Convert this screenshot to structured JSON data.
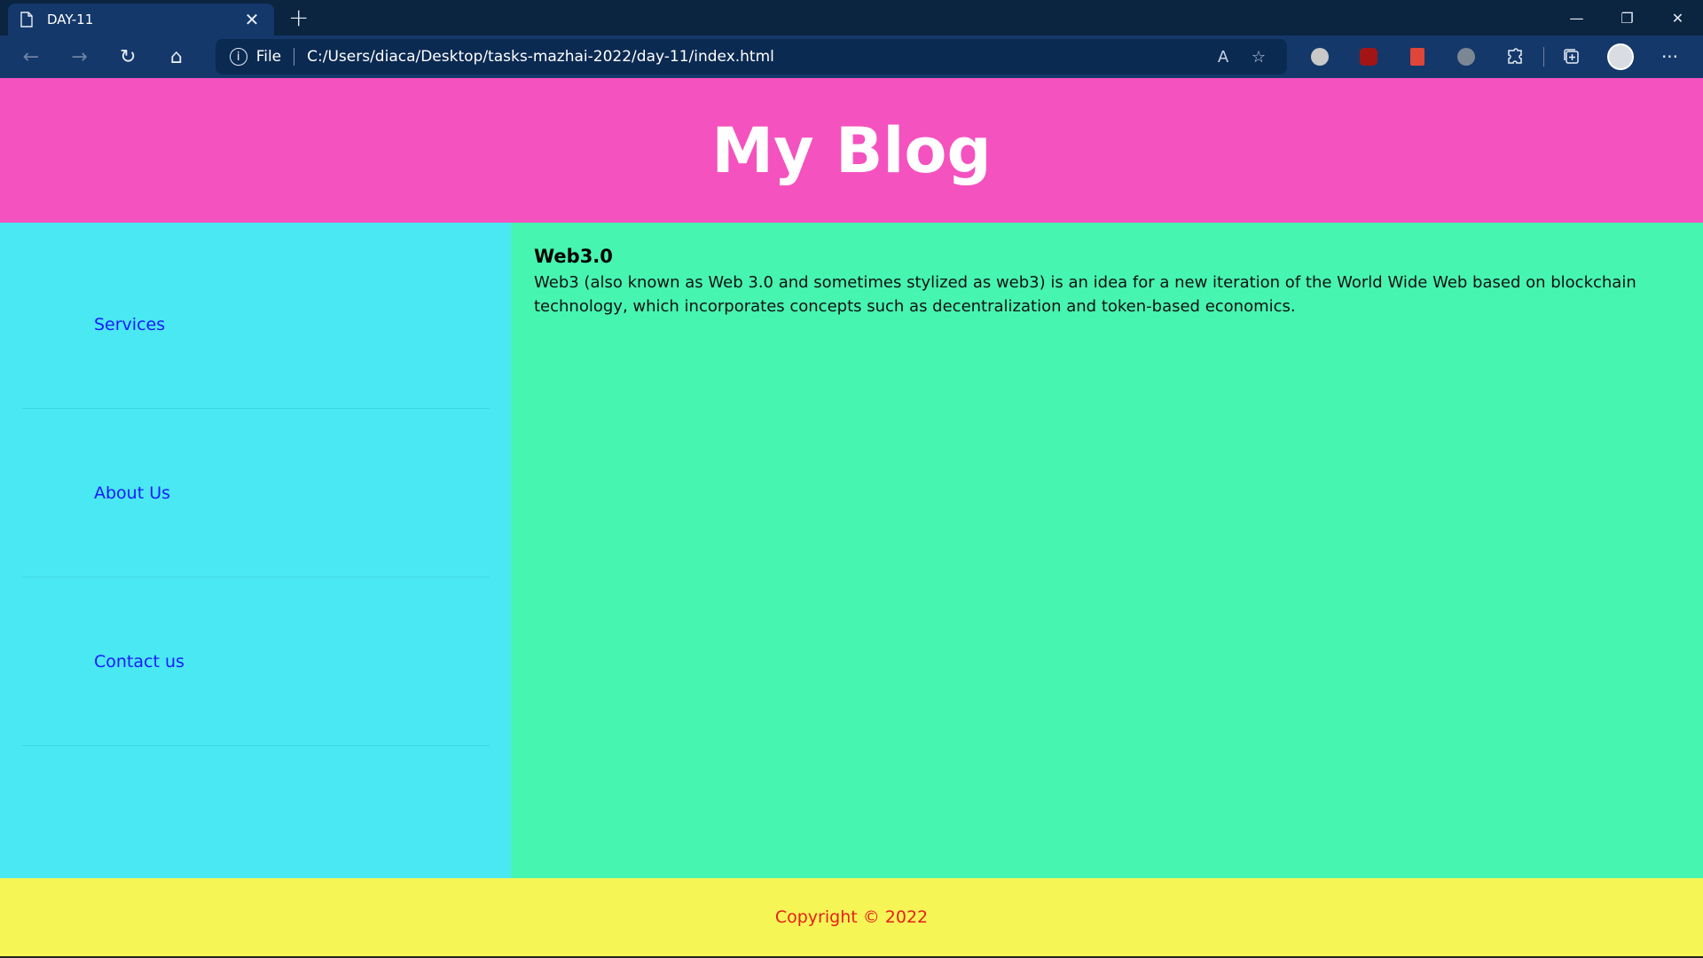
{
  "browser": {
    "tab_title": "DAY-11",
    "tab_close": "✕",
    "new_tab": "+",
    "window_controls": {
      "minimize": "—",
      "restore": "❐",
      "close": "✕"
    },
    "nav": {
      "back": "←",
      "forward": "→",
      "reload": "↻",
      "home": "⌂"
    },
    "address": {
      "info": "i",
      "scheme": "File",
      "url": "C:/Users/diaca/Desktop/tasks-mazhai-2022/day-11/index.html"
    },
    "address_icons": {
      "read_aloud": "A",
      "favorite": "☆"
    },
    "extensions": [
      {
        "name": "ext-owl",
        "color": "#c9c9c9"
      },
      {
        "name": "ext-ublock",
        "color": "#a31515"
      },
      {
        "name": "ext-red-book",
        "color": "#e0453a"
      },
      {
        "name": "ext-puzzle-x",
        "color": "#7c8794"
      }
    ],
    "more": "···"
  },
  "site": {
    "title": "My Blog",
    "sidebar": [
      "Services",
      "About Us",
      "Contact us"
    ],
    "article": {
      "heading": "Web3.0",
      "body": "Web3 (also known as Web 3.0 and sometimes stylized as web3) is an idea for a new iteration of the World Wide Web based on blockchain technology, which incorporates concepts such as decentralization and token-based economics."
    },
    "footer": "Copyright © 2022"
  },
  "colors": {
    "header_bg": "#f452bf",
    "sidebar_bg": "#4ae8f2",
    "content_bg": "#46f5b0",
    "footer_bg": "#f5f556",
    "footer_text": "#e8201a",
    "link": "#1a1aff"
  }
}
